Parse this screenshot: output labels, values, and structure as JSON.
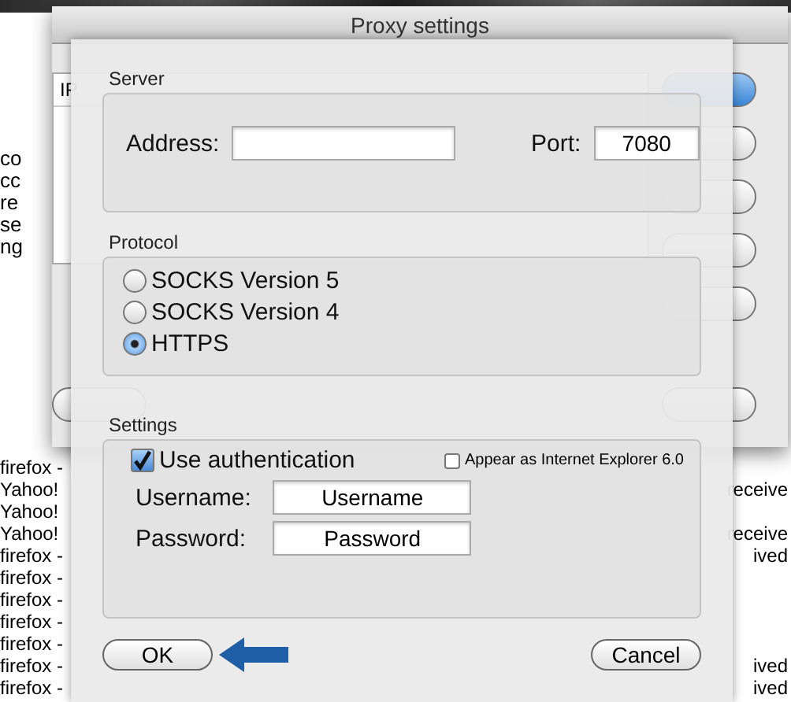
{
  "window": {
    "title": "Proxy settings"
  },
  "background_list": {
    "header": "IP",
    "fragments": [
      "co",
      "cc",
      "re",
      "se",
      "ng"
    ]
  },
  "log": [
    {
      "source": "firefox -"
    },
    {
      "source": "Yahoo!",
      "tail": "receive"
    },
    {
      "source": "Yahoo!"
    },
    {
      "source": "Yahoo!",
      "tail": "receive"
    },
    {
      "source": "firefox -",
      "tail": "ived"
    },
    {
      "source": "firefox -"
    },
    {
      "source": "firefox -"
    },
    {
      "source": "firefox -"
    },
    {
      "source": "firefox -"
    },
    {
      "source": "firefox -",
      "tail": "ived"
    },
    {
      "source": "firefox -",
      "tail": "ived"
    }
  ],
  "sheet": {
    "server": {
      "label": "Server",
      "address_label": "Address:",
      "port_label": "Port:",
      "port": "7080"
    },
    "protocol": {
      "label": "Protocol",
      "options": [
        {
          "label": "SOCKS Version 5",
          "selected": false
        },
        {
          "label": "SOCKS Version 4",
          "selected": false
        },
        {
          "label": "HTTPS",
          "selected": true
        }
      ]
    },
    "settings": {
      "label": "Settings",
      "use_auth": {
        "label": "Use authentication",
        "checked": true
      },
      "ie6": {
        "label": "Appear as Internet Explorer 6.0",
        "checked": false
      },
      "username_label": "Username:",
      "username": "Username",
      "password_label": "Password:",
      "password": "Password"
    },
    "buttons": [
      {
        "label": "OK"
      },
      {
        "label": "Cancel"
      }
    ]
  }
}
